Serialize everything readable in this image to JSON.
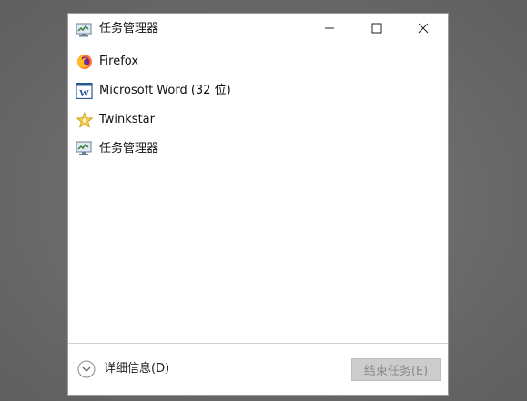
{
  "window": {
    "title": "任务管理器",
    "title_icon": "task-manager-icon",
    "controls": {
      "minimize_icon": "minimize-icon",
      "maximize_icon": "maximize-icon",
      "close_icon": "close-icon"
    }
  },
  "apps": [
    {
      "label": "Firefox",
      "icon": "firefox-icon"
    },
    {
      "label": "Microsoft Word (32 位)",
      "icon": "word-icon"
    },
    {
      "label": "Twinkstar",
      "icon": "twinkstar-icon"
    },
    {
      "label": "任务管理器",
      "icon": "task-manager-icon"
    }
  ],
  "footer": {
    "details_label": "详细信息(D)",
    "details_icon": "chevron-down-icon",
    "end_task_label": "结束任务(E)",
    "end_task_enabled": false
  },
  "colors": {
    "desktop": "#6b6b6b",
    "window_bg": "#ffffff",
    "disabled_button_bg": "#cccccc",
    "disabled_button_text": "#8a8a8a",
    "close_hover": "#e81123"
  }
}
